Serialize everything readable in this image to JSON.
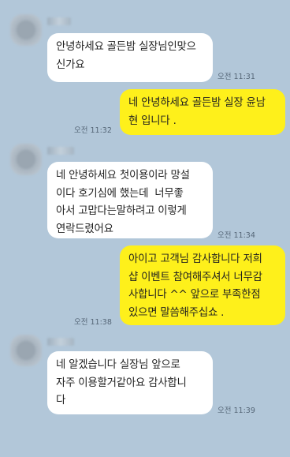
{
  "messages": [
    {
      "sender": "other",
      "text": "안녕하세요 골든밤 실장님인맞으\n신가요",
      "time": "오전 11:31"
    },
    {
      "sender": "me",
      "text": "네 안녕하세요 골든밤 실장 윤남\n현 입니다 .",
      "time": "오전 11:32"
    },
    {
      "sender": "other",
      "text": "네 안녕하세요 첫이용이라 망설\n이다 호기심에 했는데  너무좋\n아서 고맙다는말하려고 이렇게\n연락드렸어요",
      "time": "오전 11:34"
    },
    {
      "sender": "me",
      "text": "아이고 고객님 감사합니다 저희\n샵 이벤트 참여해주셔서 너무감\n사합니다 ^^ 앞으로 부족한점\n있으면 말씀해주십쇼 .",
      "time": "오전 11:38"
    },
    {
      "sender": "other",
      "text": "네 알겠습니다 실장님 앞으로\n자주 이용할거같아요 감사합니\n다",
      "time": "오전 11:39"
    }
  ]
}
